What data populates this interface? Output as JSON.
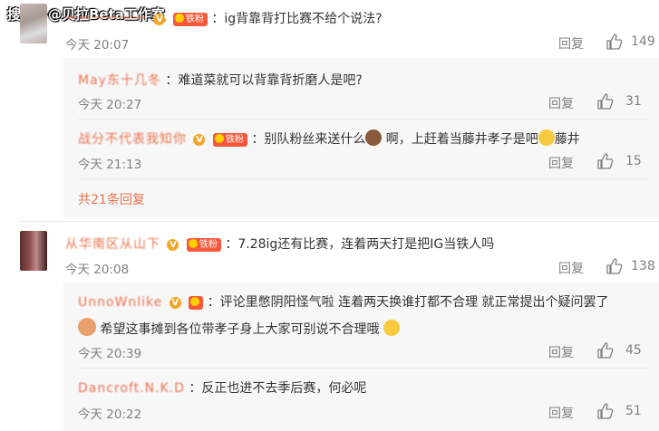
{
  "watermark": "搜狐号@贝拉Beta工作室",
  "comments": [
    {
      "username": "一一一一一一",
      "text": "：ig背靠背打比赛不给个说法?",
      "time": "今天 20:07",
      "reply_label": "回复",
      "likes": "149",
      "replies": [
        {
          "username": "May东十几冬",
          "text": "：难道菜就可以背靠背折磨人是吧?",
          "time": "今天 20:27",
          "reply_label": "回复",
          "likes": "31"
        },
        {
          "username": "战分不代表我知你",
          "text_before": "：别队粉丝来送什么",
          "text_mid": " 啊，上赶着当藤井孝子是吧",
          "text_after": "藤井",
          "time": "今天 21:13",
          "reply_label": "回复",
          "likes": "15"
        }
      ],
      "more_replies": "共21条回复"
    },
    {
      "username": "从华南区从山下",
      "text": "：7.28ig还有比赛，连着两天打是把IG当铁人吗",
      "time": "今天 20:08",
      "reply_label": "回复",
      "likes": "138",
      "replies": [
        {
          "username": "UnnoWnlike",
          "text_line1": "：评论里憋阴阳怪气啦 连着两天换谁打都不合理 就正常提出个疑问罢了",
          "text_line2": "希望这事摊到各位带孝子身上大家可别说不合理哦",
          "time": "今天 20:39",
          "reply_label": "回复",
          "likes": "45"
        },
        {
          "username": "Dancroft.N.K.D",
          "text": "：反正也进不去季后赛，何必呢",
          "time": "今天 20:22",
          "reply_label": "回复",
          "likes": "51"
        }
      ]
    }
  ],
  "badges": {
    "v": "V",
    "fan": "铁粉"
  },
  "colors": {
    "accent": "#eb7350",
    "meta": "#808080",
    "subbg": "#f7f7f7"
  }
}
